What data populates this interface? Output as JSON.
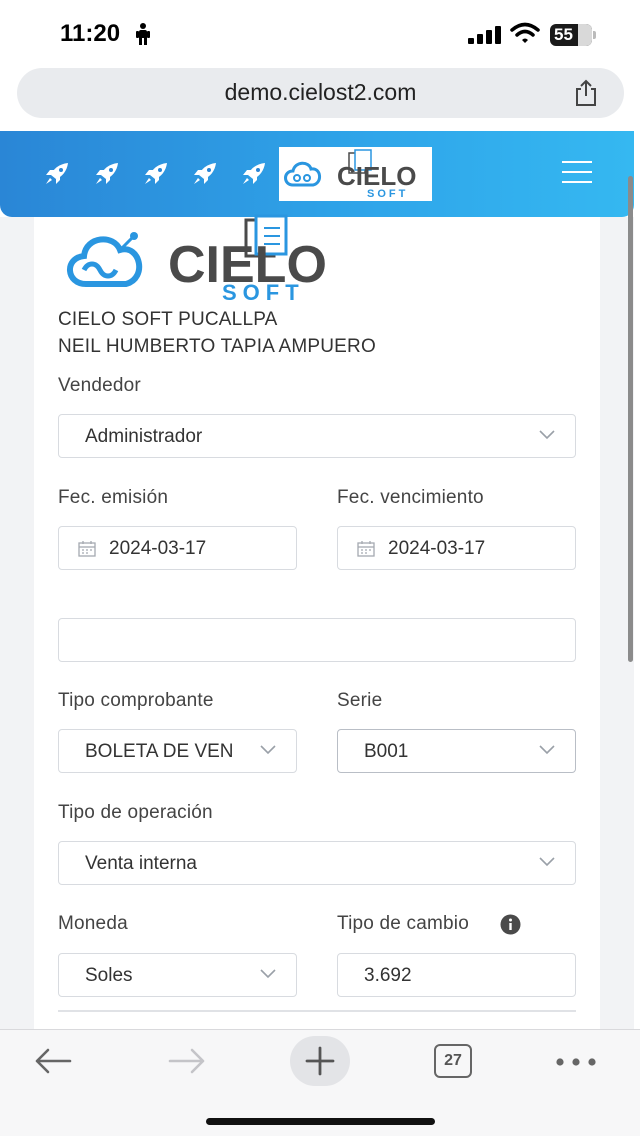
{
  "status_bar": {
    "time": "11:20",
    "battery": "55"
  },
  "browser": {
    "url": "demo.cielost2.com",
    "tab_count": "27"
  },
  "brand": {
    "logo_main": "CIELO",
    "logo_sub": "SOFT",
    "accent": "#2a96e0",
    "dark": "#4a4a4a"
  },
  "company": {
    "name": "CIELO SOFT PUCALLPA",
    "owner": "NEIL HUMBERTO TAPIA AMPUERO"
  },
  "form": {
    "vendedor": {
      "label": "Vendedor",
      "value": "Administrador"
    },
    "fec_emision": {
      "label": "Fec. emisión",
      "value": "2024-03-17"
    },
    "fec_vencimiento": {
      "label": "Fec. vencimiento",
      "value": "2024-03-17"
    },
    "blank_field": {
      "value": ""
    },
    "tipo_comprobante": {
      "label": "Tipo comprobante",
      "value": "BOLETA DE VEN"
    },
    "serie": {
      "label": "Serie",
      "value": "B001"
    },
    "tipo_operacion": {
      "label": "Tipo de operación",
      "value": "Venta interna"
    },
    "moneda": {
      "label": "Moneda",
      "value": "Soles"
    },
    "tipo_cambio": {
      "label": "Tipo de cambio",
      "value": "3.692"
    }
  }
}
